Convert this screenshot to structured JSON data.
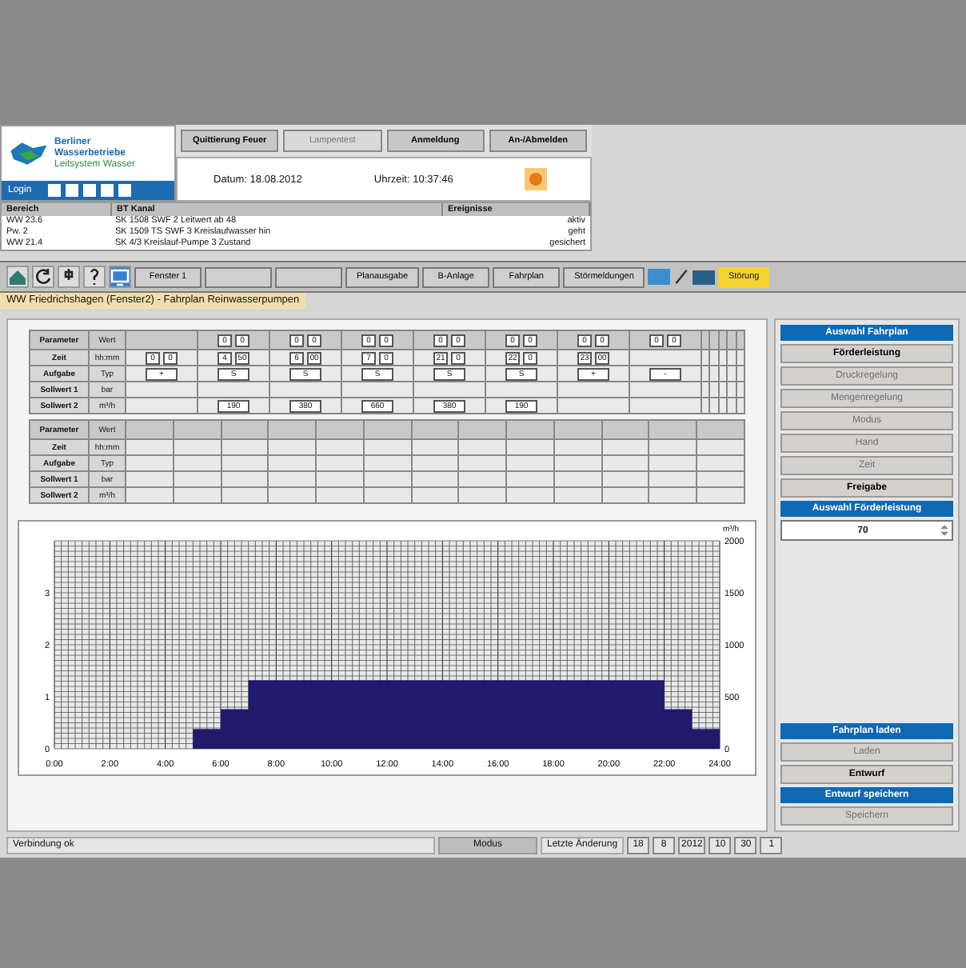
{
  "logo": {
    "lines": [
      "Berliner",
      "Wasserbetriebe",
      "Leitsystem Wasser"
    ],
    "login": "Login"
  },
  "header_buttons": [
    {
      "label": "Quittierung Feuer",
      "disabled": false
    },
    {
      "label": "Lampentest",
      "disabled": true
    },
    {
      "label": "Anmeldung",
      "disabled": false
    },
    {
      "label": "An-/Abmelden",
      "disabled": false
    }
  ],
  "date": "Datum: 18.08.2012",
  "time": "Uhrzeit: 10:37:46",
  "events": {
    "columns": [
      "Bereich",
      "BT Kanal",
      "Ereignisse"
    ],
    "rows": [
      [
        "WW 23.6",
        "SK 1508 SWF 2 Leitwert ab 48",
        "aktiv"
      ],
      [
        "Pw. 2",
        "SK 1509 TS SWF 3 Kreislaufwasser hin",
        "geht"
      ],
      [
        "WW 21.4",
        "SK 4/3 Kreislauf-Pumpe 3 Zustand",
        "gesichert"
      ]
    ]
  },
  "toolbar": {
    "buttons": [
      {
        "kind": "text",
        "label": "Fenster 1"
      },
      {
        "kind": "blank"
      },
      {
        "kind": "blank"
      },
      {
        "kind": "text",
        "label": "Planausgabe"
      },
      {
        "kind": "text",
        "label": "B-Anlage"
      },
      {
        "kind": "text",
        "label": "Fahrplan"
      },
      {
        "kind": "text",
        "label": "Störmeldungen"
      }
    ],
    "alarm": "Störung"
  },
  "page_title": "WW Friedrichshagen (Fenster2) - Fahrplan Reinwasserpumpen",
  "table1": {
    "header": [
      "Parameter",
      "Wert"
    ],
    "slots": [
      "0",
      "0",
      "0",
      "0",
      "0",
      "0",
      "0",
      "0",
      "0",
      "0",
      "0",
      "0",
      "0",
      "0"
    ],
    "rows": [
      {
        "label": "Zeit",
        "unit": "hh:mm",
        "values": [
          "0",
          "0",
          "4",
          "50",
          "6",
          "00",
          "7",
          "0",
          "21",
          "0",
          "22",
          "0",
          "23",
          "00"
        ]
      },
      {
        "label": "Aufgabe",
        "unit": "Typ",
        "cells": [
          {
            "kind": "field",
            "text": "+"
          },
          {
            "kind": "field",
            "text": "S"
          },
          {
            "kind": "field",
            "text": "S"
          },
          {
            "kind": "field",
            "text": "S"
          },
          {
            "kind": "field",
            "text": "S"
          },
          {
            "kind": "field",
            "text": "S"
          },
          {
            "kind": "field",
            "text": "+"
          },
          {
            "kind": "field",
            "text": "-"
          }
        ]
      },
      {
        "label": "Sollwert 1",
        "unit": "bar"
      },
      {
        "label": "Sollwert 2",
        "unit": "m³/h",
        "cells": [
          {
            "kind": "empty"
          },
          {
            "kind": "field",
            "text": "190"
          },
          {
            "kind": "field",
            "text": "380"
          },
          {
            "kind": "field",
            "text": "660"
          },
          {
            "kind": "field",
            "text": "380"
          },
          {
            "kind": "field",
            "text": "190"
          }
        ]
      }
    ]
  },
  "table2": {
    "header": [
      "Parameter",
      "Wert"
    ],
    "rows": [
      {
        "label": "Zeit",
        "unit": "hh:mm"
      },
      {
        "label": "Aufgabe",
        "unit": "Typ"
      },
      {
        "label": "Sollwert 1",
        "unit": "bar"
      },
      {
        "label": "Sollwert 2",
        "unit": "m³/h"
      }
    ]
  },
  "chart": {
    "left_ticks": [
      "3",
      "2",
      "1",
      "0"
    ],
    "chart_data": {
      "type": "area",
      "ylabel": "m³/h",
      "grid": true,
      "x": [
        0,
        5,
        5,
        6,
        6,
        7,
        7,
        22,
        22,
        23,
        23,
        24
      ],
      "series": [
        {
          "color": "#1f1a6e",
          "values": [
            0,
            0,
            190,
            190,
            380,
            380,
            660,
            660,
            380,
            380,
            190,
            190
          ]
        }
      ],
      "ylim": [
        0,
        2000
      ],
      "yticks": [
        0,
        500,
        1000,
        1500,
        2000
      ],
      "xlim": [
        0,
        24
      ],
      "xticks": [
        {
          "value": 0,
          "label": "0:00"
        },
        {
          "value": 2,
          "label": "2:00"
        },
        {
          "value": 4,
          "label": "4:00"
        },
        {
          "value": 6,
          "label": "6:00"
        },
        {
          "value": 8,
          "label": "8:00"
        },
        {
          "value": 10,
          "label": "10:00"
        },
        {
          "value": 12,
          "label": "12:00"
        },
        {
          "value": 14,
          "label": "14:00"
        },
        {
          "value": 16,
          "label": "16:00"
        },
        {
          "value": 18,
          "label": "18:00"
        },
        {
          "value": 20,
          "label": "20:00"
        },
        {
          "value": 22,
          "label": "22:00"
        },
        {
          "value": 24,
          "label": "24:00"
        }
      ]
    }
  },
  "side": {
    "sections": [
      {
        "title": "Auswahl Fahrplan",
        "buttons": [
          {
            "label": "Förderleistung",
            "disabled": false
          },
          {
            "label": "Druckregelung",
            "disabled": true
          },
          {
            "label": "Mengenregelung",
            "disabled": true
          },
          {
            "label": "Modus",
            "disabled": true
          },
          {
            "label": "Hand",
            "disabled": true
          },
          {
            "label": "Zeit",
            "disabled": true
          },
          {
            "label": "Freigabe",
            "disabled": false
          }
        ]
      },
      {
        "title": "Auswahl Förderleistung",
        "spin": "70"
      },
      {
        "title": "Fahrplan laden",
        "buttons": [
          {
            "label": "Laden",
            "disabled": true
          },
          {
            "label": "Entwurf",
            "disabled": false
          }
        ]
      },
      {
        "title": "Entwurf speichern",
        "buttons": [
          {
            "label": "Speichern",
            "disabled": true
          }
        ]
      }
    ]
  },
  "status": {
    "message": "Verbindung ok",
    "mode": "Modus",
    "last_change_label": "Letzte Änderung",
    "date_parts": [
      "18",
      "8",
      "2012"
    ],
    "time_parts": [
      "10",
      "30",
      "1"
    ]
  }
}
